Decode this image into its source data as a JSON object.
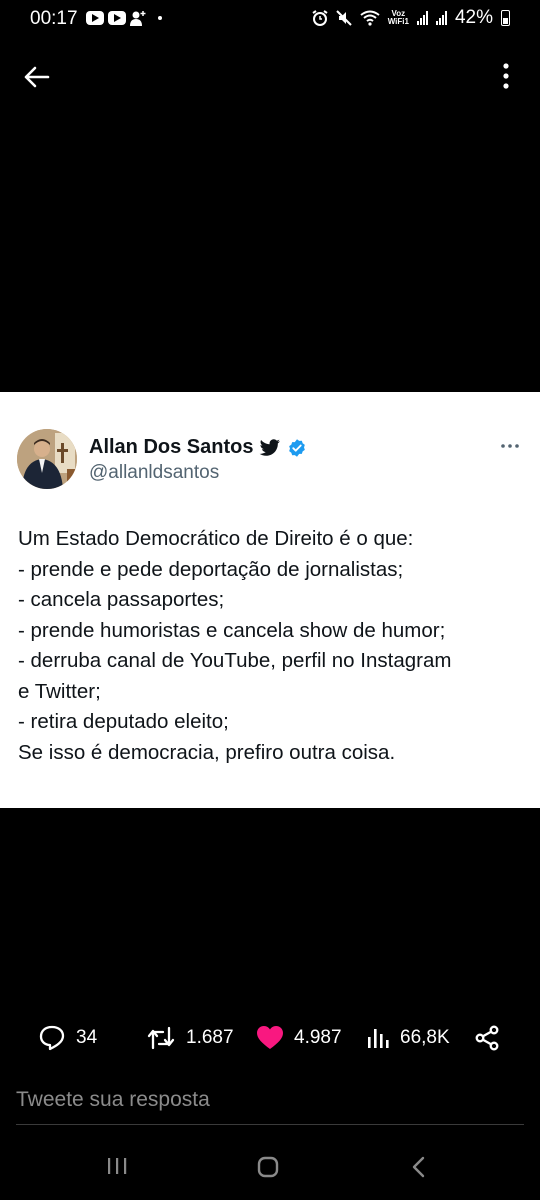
{
  "status_bar": {
    "time": "00:17",
    "wifi_label_top": "Voz",
    "wifi_label_bottom": "WiFi1",
    "battery": "42%"
  },
  "tweet": {
    "author_name": "Allan Dos Santos",
    "handle": "@allanldsantos",
    "lines": [
      "Um Estado Democrático de Direito é o que:",
      "- prende e pede deportação de jornalistas;",
      "- cancela passaportes;",
      "- prende humoristas e cancela show de humor;",
      "- derruba canal de YouTube, perfil no Instagram",
      "e Twitter;",
      "- retira deputado eleito;",
      "Se isso é democracia, prefiro outra coisa."
    ]
  },
  "actions": {
    "replies": "34",
    "retweets": "1.687",
    "likes": "4.987",
    "views": "66,8K"
  },
  "reply_placeholder": "Tweete sua resposta",
  "colors": {
    "background": "#000000",
    "card": "#ffffff",
    "verified": "#1d9bf0",
    "like": "#f91880",
    "handle": "#536471"
  }
}
